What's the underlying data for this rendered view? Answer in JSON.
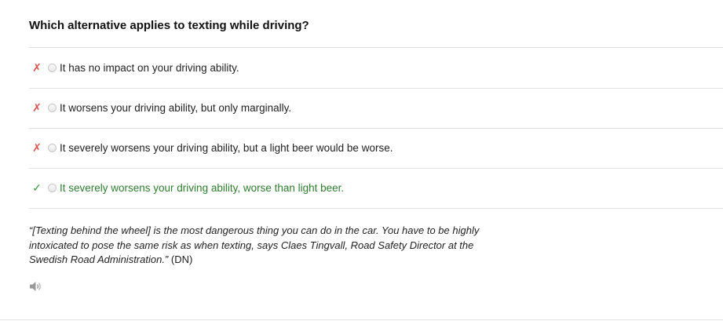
{
  "question": "Which alternative applies to texting while driving?",
  "options": [
    {
      "mark": "✗",
      "status": "wrong",
      "text": "It has no impact on your driving ability."
    },
    {
      "mark": "✗",
      "status": "wrong",
      "text": "It worsens your driving ability, but only marginally."
    },
    {
      "mark": "✗",
      "status": "wrong",
      "text": "It severely worsens your driving ability, but a light beer would be worse."
    },
    {
      "mark": "✓",
      "status": "correct",
      "text": "It severely worsens your driving ability, worse than light beer."
    }
  ],
  "explanation": {
    "quote": "“[Texting behind the wheel] is the most dangerous thing you can do in the car. You have to be highly intoxicated to pose the same risk as when texting, says Claes Tingvall, Road Safety Director at the Swedish Road Administration.”",
    "source": " (DN)"
  },
  "icons": {
    "audio": "speaker-icon"
  },
  "colors": {
    "wrong_mark": "#d9534f",
    "correct_mark": "#3c9a3c",
    "correct_text": "#2e7d2e"
  }
}
